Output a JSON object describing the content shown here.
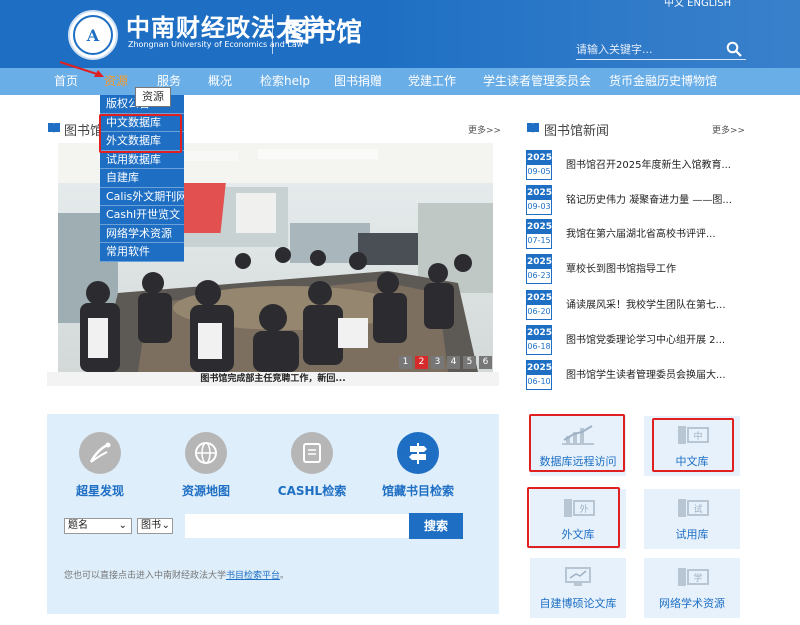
{
  "header": {
    "seal_char": "A",
    "uni_cn": "中南财经政法大学",
    "uni_en": "Zhongnan University of Economics and Law",
    "library": "图书馆",
    "lang": "中文 ENGLISH",
    "search_placeholder": "请输入关键字..."
  },
  "nav": [
    {
      "label": "首页"
    },
    {
      "label": "资源"
    },
    {
      "label": "服务"
    },
    {
      "label": "概况"
    },
    {
      "label": "检索help"
    },
    {
      "label": "图书捐赠"
    },
    {
      "label": "党建工作"
    },
    {
      "label": "学生读者管理委员会"
    },
    {
      "label": "货币金融历史博物馆"
    }
  ],
  "dropdown": {
    "tooltip": "资源",
    "items": [
      "版权公告",
      "中文数据库",
      "外文数据库",
      "试用数据库",
      "自建库",
      "Calis外文期刊网",
      "Cashl开世览文",
      "网络学术资源",
      "常用软件"
    ]
  },
  "sections": {
    "lib_title": "图书馆",
    "news_title": "图书馆新闻",
    "more": "更多>>"
  },
  "carousel": {
    "caption": "图书馆完成部主任竞聘工作，新回...",
    "pages": [
      "1",
      "2",
      "3",
      "4",
      "5",
      "6"
    ],
    "active_page": "2"
  },
  "news": [
    {
      "year": "2025",
      "date": "09-05",
      "title": "图书馆召开2025年度新生入馆教育..."
    },
    {
      "year": "2025",
      "date": "09-03",
      "title": "铭记历史伟力 凝聚奋进力量 ——图..."
    },
    {
      "year": "2025",
      "date": "07-15",
      "title": "我馆在第六届湖北省高校书评评..."
    },
    {
      "year": "2025",
      "date": "06-23",
      "title": "覃校长到图书馆指导工作"
    },
    {
      "year": "2025",
      "date": "06-20",
      "title": "诵读展风采！我校学生团队在第七..."
    },
    {
      "year": "2025",
      "date": "06-18",
      "title": "图书馆党委理论学习中心组开展 2..."
    },
    {
      "year": "2025",
      "date": "06-10",
      "title": "图书馆学生读者管理委员会换届大..."
    }
  ],
  "tools": [
    {
      "label": "超星发现"
    },
    {
      "label": "资源地图"
    },
    {
      "label": "CASHL检索"
    },
    {
      "label": "馆藏书目检索"
    }
  ],
  "search": {
    "field": "题名",
    "type": "图书",
    "button": "搜索",
    "note_prefix": "您也可以直接点击进入中南财经政法大学",
    "note_link": "书目检索平台",
    "note_suffix": "。"
  },
  "tiles": [
    {
      "label": "数据库远程访问",
      "icon_text": ""
    },
    {
      "label": "中文库",
      "icon_text": "中"
    },
    {
      "label": "外文库",
      "icon_text": "外"
    },
    {
      "label": "试用库",
      "icon_text": "试"
    },
    {
      "label": "自建博硕论文库",
      "icon_text": ""
    },
    {
      "label": "网络学术资源",
      "icon_text": "学"
    }
  ],
  "colors": {
    "brand_blue": "#1e6fc4",
    "nav_blue": "#6aaee8",
    "highlight_red": "#e02020",
    "active_nav": "#f39c2b"
  }
}
